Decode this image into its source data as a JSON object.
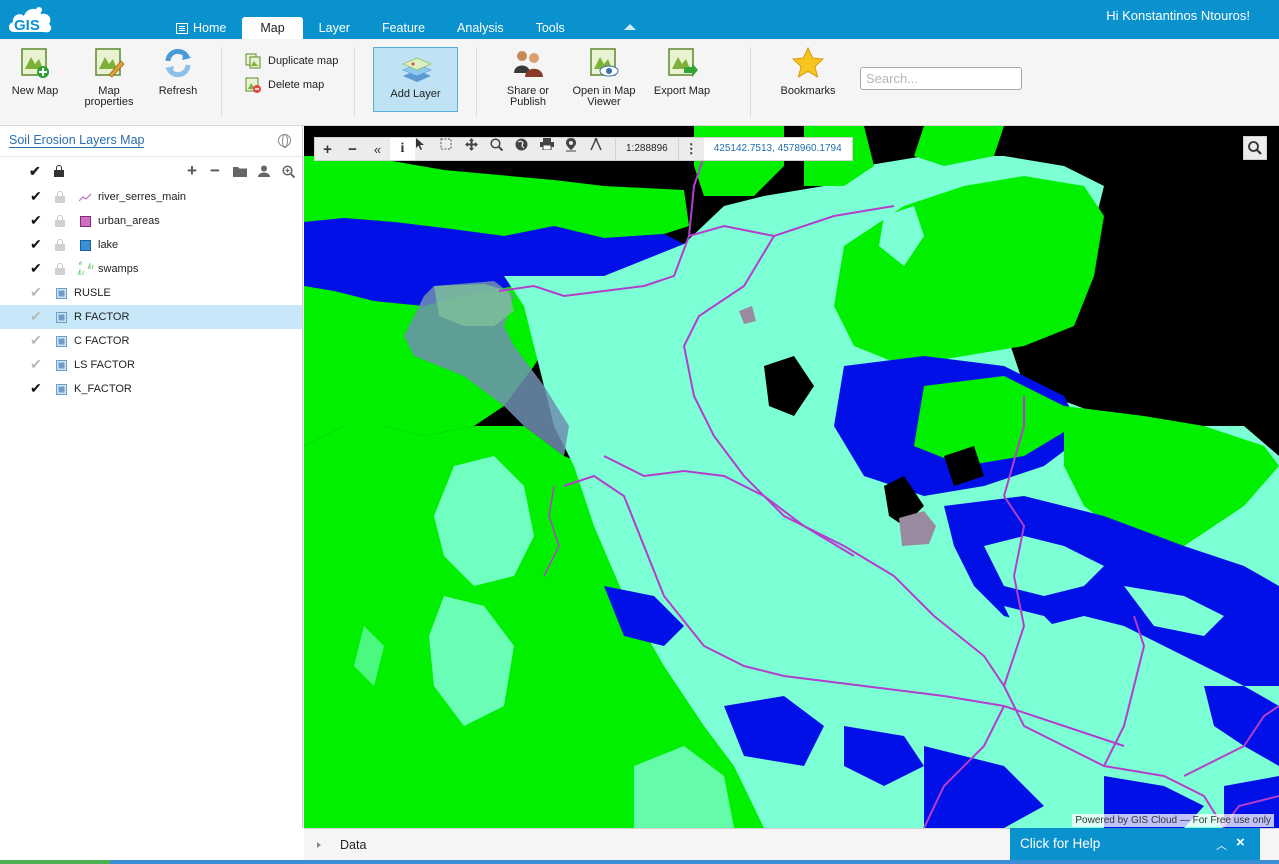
{
  "app": {
    "greeting": "Hi Konstantinos Ntouros!",
    "logo_text": "GIS"
  },
  "nav_tabs": [
    {
      "label": "Home"
    },
    {
      "label": "Map"
    },
    {
      "label": "Layer"
    },
    {
      "label": "Feature"
    },
    {
      "label": "Analysis"
    },
    {
      "label": "Tools"
    }
  ],
  "ribbon": {
    "new_map": "New Map",
    "map_properties_1": "Map",
    "map_properties_2": "properties",
    "refresh": "Refresh",
    "duplicate_map": "Duplicate map",
    "delete_map": "Delete map",
    "add_layer": "Add Layer",
    "share_1": "Share or",
    "share_2": "Publish",
    "open_viewer_1": "Open in Map",
    "open_viewer_2": "Viewer",
    "export_map": "Export Map",
    "bookmarks": "Bookmarks",
    "search_placeholder": "Search..."
  },
  "sidebar": {
    "map_title": "Soil Erosion Layers Map",
    "layers": [
      {
        "name": "river_serres_main",
        "checked": true,
        "symbol": "line",
        "color": "#c36bc9"
      },
      {
        "name": "urban_areas",
        "checked": true,
        "symbol": "fill",
        "color": "#d16fc5"
      },
      {
        "name": "lake",
        "checked": true,
        "symbol": "fill",
        "color": "#3b8fd6"
      },
      {
        "name": "swamps",
        "checked": true,
        "symbol": "marsh",
        "color": "#5cc45c"
      },
      {
        "name": "RUSLE",
        "checked": false,
        "symbol": "raster"
      },
      {
        "name": "R FACTOR",
        "checked": false,
        "symbol": "raster",
        "selected": true
      },
      {
        "name": "C FACTOR",
        "checked": false,
        "symbol": "raster"
      },
      {
        "name": "LS FACTOR",
        "checked": false,
        "symbol": "raster"
      },
      {
        "name": "K_FACTOR",
        "checked": true,
        "symbol": "raster"
      }
    ]
  },
  "map": {
    "scale": "1:288896",
    "coordinates": "425142.7513, 4578960.1794",
    "powered_by": "Powered by GIS Cloud — For Free use only"
  },
  "bottom": {
    "data_label": "Data",
    "help_label": "Click for Help"
  },
  "colors": {
    "brand": "#0a92cf",
    "selected_row": "#c7e8f9",
    "map_green": "#00f000",
    "map_blue": "#0010e6",
    "map_aqua": "#7dffd6",
    "map_river": "#b43ecc"
  }
}
